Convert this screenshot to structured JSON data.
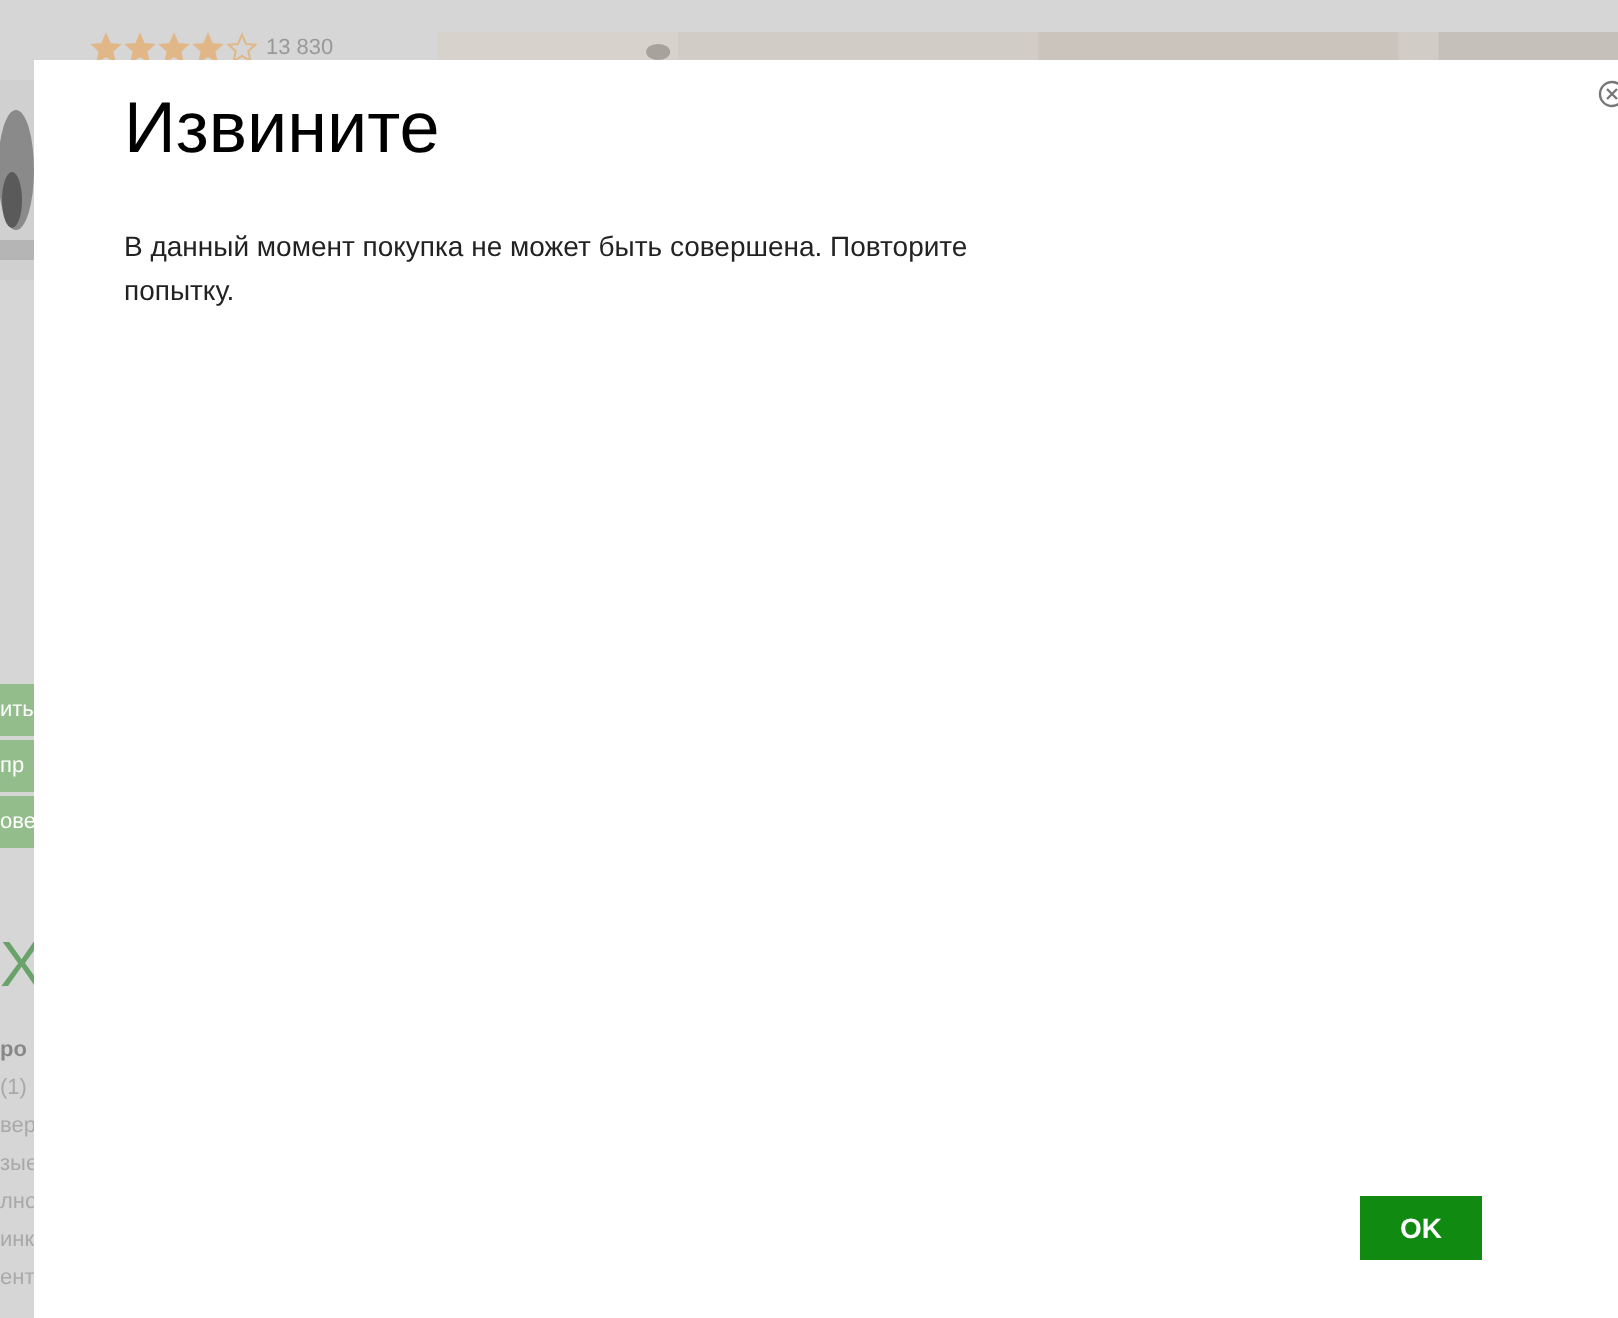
{
  "background": {
    "rating": {
      "stars": 4,
      "count": "13 830"
    },
    "side_buttons": [
      "ить",
      "пр",
      "ове"
    ],
    "side_heading": "Х",
    "side_lines": [
      "ро",
      "(1)",
      "вер",
      "зые",
      "лно",
      "инк",
      "ент"
    ]
  },
  "dialog": {
    "title": "Извините",
    "message": "В данный момент покупка не может быть совершена. Повторите попытку.",
    "buttons": [
      "OK"
    ]
  }
}
